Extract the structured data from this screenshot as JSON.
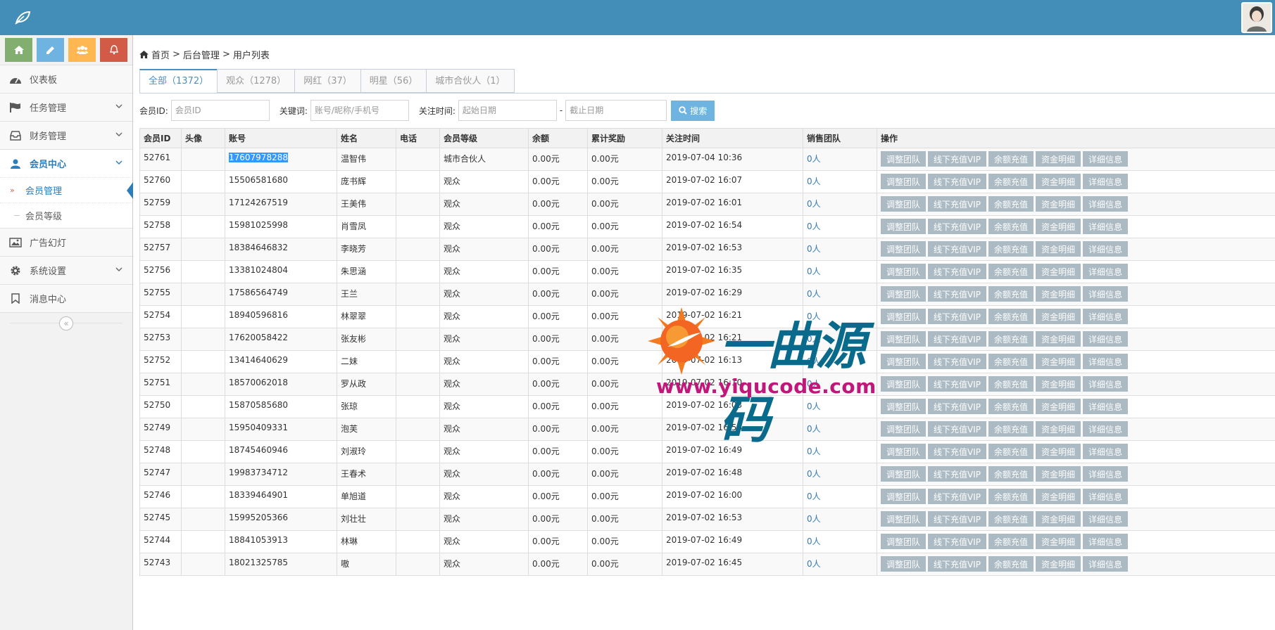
{
  "breadcrumb": [
    "首页",
    "后台管理",
    "用户列表"
  ],
  "breadcrumb_sep": ">",
  "shortcuts": [
    {
      "icon": "home-icon",
      "color": "#82af6f"
    },
    {
      "icon": "pencil-icon",
      "color": "#6fb3e0"
    },
    {
      "icon": "users-icon",
      "color": "#ffb752"
    },
    {
      "icon": "bell-icon",
      "color": "#d15b47"
    }
  ],
  "nav": {
    "dashboard": "仪表板",
    "tasks": "任务管理",
    "finance": "财务管理",
    "members": "会员中心",
    "member_manage": "会员管理",
    "member_level": "会员等级",
    "ads": "广告幻灯",
    "settings": "系统设置",
    "messages": "消息中心",
    "collapse": "«"
  },
  "tabs": [
    "全部（1372）",
    "观众（1278）",
    "网红（37）",
    "明星（56）",
    "城市合伙人（1）"
  ],
  "filters": {
    "member_id_label": "会员ID:",
    "member_id_placeholder": "会员ID",
    "keyword_label": "关键词:",
    "keyword_placeholder": "账号/昵称/手机号",
    "follow_time_label": "关注时间:",
    "start_placeholder": "起始日期",
    "range_sep": "-",
    "end_placeholder": "截止日期",
    "search_label": "搜索"
  },
  "table": {
    "columns": [
      "会员ID",
      "头像",
      "账号",
      "姓名",
      "电话",
      "会员等级",
      "余额",
      "累计奖励",
      "关注时间",
      "销售团队",
      "操作"
    ],
    "actions": [
      "调整团队",
      "线下充值VIP",
      "余额充值",
      "资金明细",
      "详细信息"
    ],
    "rows": [
      [
        "52761",
        "17607978288",
        "温智伟",
        "城市合伙人",
        "0.00元",
        "0.00元",
        "2019-07-04 10:36",
        "0人"
      ],
      [
        "52760",
        "15506581680",
        "庞书辉",
        "观众",
        "0.00元",
        "0.00元",
        "2019-07-02 16:07",
        "0人"
      ],
      [
        "52759",
        "17124267519",
        "王美伟",
        "观众",
        "0.00元",
        "0.00元",
        "2019-07-02 16:01",
        "0人"
      ],
      [
        "52758",
        "15981025998",
        "肖雪凤",
        "观众",
        "0.00元",
        "0.00元",
        "2019-07-02 16:54",
        "0人"
      ],
      [
        "52757",
        "18384646832",
        "李晓芳",
        "观众",
        "0.00元",
        "0.00元",
        "2019-07-02 16:53",
        "0人"
      ],
      [
        "52756",
        "13381024804",
        "朱思涵",
        "观众",
        "0.00元",
        "0.00元",
        "2019-07-02 16:35",
        "0人"
      ],
      [
        "52755",
        "17586564749",
        "王兰",
        "观众",
        "0.00元",
        "0.00元",
        "2019-07-02 16:29",
        "0人"
      ],
      [
        "52754",
        "18940596816",
        "林翠翠",
        "观众",
        "0.00元",
        "0.00元",
        "2019-07-02 16:21",
        "0人"
      ],
      [
        "52753",
        "17620058422",
        "张友彬",
        "观众",
        "0.00元",
        "0.00元",
        "2019-07-02 16:21",
        "0人"
      ],
      [
        "52752",
        "13414640629",
        "二妹",
        "观众",
        "0.00元",
        "0.00元",
        "2019-07-02 16:13",
        "0人"
      ],
      [
        "52751",
        "18570062018",
        "罗从政",
        "观众",
        "0.00元",
        "0.00元",
        "2019-07-02 16:10",
        "0人"
      ],
      [
        "52750",
        "15870585680",
        "张琼",
        "观众",
        "0.00元",
        "0.00元",
        "2019-07-02 16:03",
        "0人"
      ],
      [
        "52749",
        "15950409331",
        "泡芙",
        "观众",
        "0.00元",
        "0.00元",
        "2019-07-02 16:56",
        "0人"
      ],
      [
        "52748",
        "18745460946",
        "刘淑玲",
        "观众",
        "0.00元",
        "0.00元",
        "2019-07-02 16:49",
        "0人"
      ],
      [
        "52747",
        "19983734712",
        "王春术",
        "观众",
        "0.00元",
        "0.00元",
        "2019-07-02 16:48",
        "0人"
      ],
      [
        "52746",
        "18339464901",
        "单旭道",
        "观众",
        "0.00元",
        "0.00元",
        "2019-07-02 16:00",
        "0人"
      ],
      [
        "52745",
        "15995205366",
        "刘壮壮",
        "观众",
        "0.00元",
        "0.00元",
        "2019-07-02 16:53",
        "0人"
      ],
      [
        "52744",
        "18841053913",
        "林琳",
        "观众",
        "0.00元",
        "0.00元",
        "2019-07-02 16:49",
        "0人"
      ],
      [
        "52743",
        "18021325785",
        "嗷",
        "观众",
        "0.00元",
        "0.00元",
        "2019-07-02 16:45",
        "0人"
      ]
    ]
  },
  "watermark": {
    "title": "一曲源码",
    "url": "www.yiqucode.com"
  },
  "colors": {
    "topbar": "#438eb9",
    "accent": "#2b7dbc",
    "action_button": "#abbac3",
    "search_button": "#6fb3e0"
  }
}
